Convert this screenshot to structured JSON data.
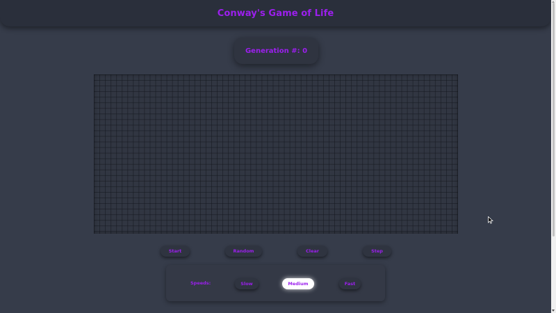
{
  "header": {
    "title": "Conway's Game of Life"
  },
  "generation": {
    "label": "Generation #: 0"
  },
  "controls": {
    "start": "Start",
    "random": "Random",
    "clear": "Clear",
    "step": "Step"
  },
  "speed": {
    "label": "Speeds:",
    "options": [
      "Slow",
      "Medium",
      "Fast"
    ],
    "selected": "Medium"
  },
  "colors": {
    "accent": "#9c1fee",
    "background": "#363c4a",
    "header": "#2a2f3b"
  }
}
